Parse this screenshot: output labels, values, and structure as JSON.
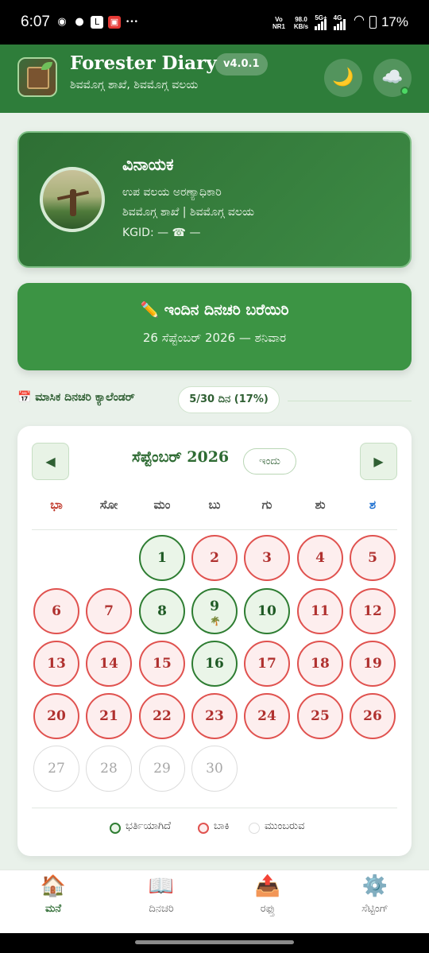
{
  "status_bar": {
    "time": "6:07",
    "net_rate": "98.0",
    "net_unit": "KB/s",
    "vo_label": "Vo",
    "nr_label": "NR1",
    "net_5g": "5G+",
    "net_4g": "4G",
    "battery": "17%"
  },
  "header": {
    "title": "Forester Diary",
    "version": "v4.0.1",
    "subtitle": "ಶಿವಮೊಗ್ಗ ಶಾಖೆ, ಶಿವಮೊಗ್ಗ ವಲಯ",
    "theme_icon": "🌙",
    "cloud_icon": "☁️"
  },
  "profile": {
    "name": "ವಿನಾಯಕ",
    "designation": "ಉಪ ವಲಯ ಅರಣ್ಯಾಧಿಕಾರಿ",
    "office": "ಶಿವಮೊಗ್ಗ ಶಾಖೆ | ಶಿವಮೊಗ್ಗ ವಲಯ",
    "ids": "KGID: — ☎ —"
  },
  "today_prompt": {
    "title": "✏️  ಇಂದಿನ ದಿನಚರಿ ಬರೆಯಿರಿ",
    "date": "26 ಸೆಪ್ಟೆಂಬರ್ 2026 — ಶನಿವಾರ"
  },
  "calendar_section": {
    "title": "📅 ಮಾಸಿಕ ದಿನಚರಿ ಕ್ಯಾಲೆಂಡರ್",
    "progress": "5/30 ದಿನ (17%)"
  },
  "calendar": {
    "month_label": "ಸೆಪ್ಟೆಂಬರ್ 2026",
    "today_label": "ಇಂದು",
    "prev_label": "◀",
    "next_label": "▶",
    "weekdays": [
      "ಭಾ",
      "ಸೋ",
      "ಮಂ",
      "ಬು",
      "ಗು",
      "ಶು",
      "ಶ"
    ],
    "weekday_colors": [
      "#c0392b",
      "#555555",
      "#555555",
      "#555555",
      "#555555",
      "#555555",
      "#1e6fd0"
    ],
    "days": [
      {
        "n": "1",
        "state": "filled"
      },
      {
        "n": "2",
        "state": "pending"
      },
      {
        "n": "3",
        "state": "pending"
      },
      {
        "n": "4",
        "state": "pending"
      },
      {
        "n": "5",
        "state": "pending"
      },
      {
        "n": "6",
        "state": "pending"
      },
      {
        "n": "7",
        "state": "pending"
      },
      {
        "n": "8",
        "state": "filled"
      },
      {
        "n": "9",
        "state": "filled",
        "mark": "🌴"
      },
      {
        "n": "10",
        "state": "filled"
      },
      {
        "n": "11",
        "state": "pending"
      },
      {
        "n": "12",
        "state": "pending"
      },
      {
        "n": "13",
        "state": "pending"
      },
      {
        "n": "14",
        "state": "pending"
      },
      {
        "n": "15",
        "state": "pending"
      },
      {
        "n": "16",
        "state": "filled"
      },
      {
        "n": "17",
        "state": "pending"
      },
      {
        "n": "18",
        "state": "pending"
      },
      {
        "n": "19",
        "state": "pending"
      },
      {
        "n": "20",
        "state": "pending"
      },
      {
        "n": "21",
        "state": "pending"
      },
      {
        "n": "22",
        "state": "pending"
      },
      {
        "n": "23",
        "state": "pending"
      },
      {
        "n": "24",
        "state": "pending"
      },
      {
        "n": "25",
        "state": "pending"
      },
      {
        "n": "26",
        "state": "pending"
      },
      {
        "n": "27",
        "state": "upcoming"
      },
      {
        "n": "28",
        "state": "upcoming"
      },
      {
        "n": "29",
        "state": "upcoming"
      },
      {
        "n": "30",
        "state": "upcoming"
      }
    ],
    "legend": {
      "filled": "ಭರ್ತಿಯಾಗಿದೆ",
      "pending": "ಬಾಕಿ",
      "upcoming": "ಮುಂಬರುವ"
    }
  },
  "bottom_nav": [
    {
      "icon": "🏠",
      "label": "ಮನೆ"
    },
    {
      "icon": "📖",
      "label": "ದಿನಚರಿ"
    },
    {
      "icon": "📤",
      "label": "ರಫ್ತು"
    },
    {
      "icon": "⚙️",
      "label": "ಸೆಟ್ಟಿಂಗ್"
    }
  ],
  "colors": {
    "primary": "#2e7d3a",
    "filled": "#2e7d32",
    "pending": "#e0524f",
    "upcoming": "#dcdcdc"
  }
}
